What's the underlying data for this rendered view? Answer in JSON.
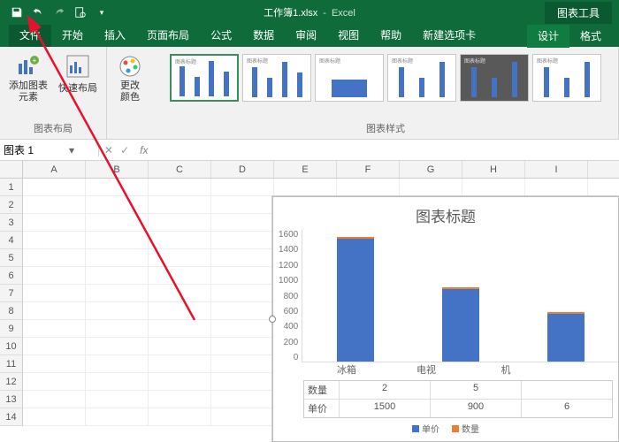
{
  "title": {
    "filename": "工作簿1.xlsx",
    "sep": "-",
    "app": "Excel",
    "tools": "图表工具"
  },
  "tabs": [
    "文件",
    "开始",
    "插入",
    "页面布局",
    "公式",
    "数据",
    "审阅",
    "视图",
    "帮助",
    "新建选项卡"
  ],
  "ctx_tabs": [
    "设计",
    "格式"
  ],
  "ribbon": {
    "layout_group": "图表布局",
    "add_element": "添加图表\n元素",
    "quick_layout": "快速布局",
    "change_colors": "更改\n颜色",
    "styles_group": "图表样式"
  },
  "namebox": "图表 1",
  "fx_label": "fx",
  "columns": [
    "A",
    "B",
    "C",
    "D",
    "E",
    "F",
    "G",
    "H",
    "I"
  ],
  "rows": [
    "1",
    "2",
    "3",
    "4",
    "5",
    "6",
    "7",
    "8",
    "9",
    "10",
    "11",
    "12",
    "13",
    "14"
  ],
  "chart_data": {
    "type": "bar",
    "title": "图表标题",
    "categories": [
      "冰箱",
      "电视",
      "机"
    ],
    "series": [
      {
        "name": "单价",
        "values": [
          1500,
          900,
          600
        ],
        "color": "#4472c4"
      },
      {
        "name": "数量",
        "values": [
          2,
          5,
          null
        ],
        "color": "#ed7d31"
      }
    ],
    "ylim": [
      0,
      1600
    ],
    "yticks": [
      0,
      200,
      400,
      600,
      800,
      1000,
      1200,
      1400,
      1600
    ],
    "data_table": {
      "rows": [
        {
          "label": "数量",
          "values": [
            "2",
            "5",
            ""
          ]
        },
        {
          "label": "单价",
          "values": [
            "1500",
            "900",
            "6"
          ]
        }
      ]
    }
  }
}
